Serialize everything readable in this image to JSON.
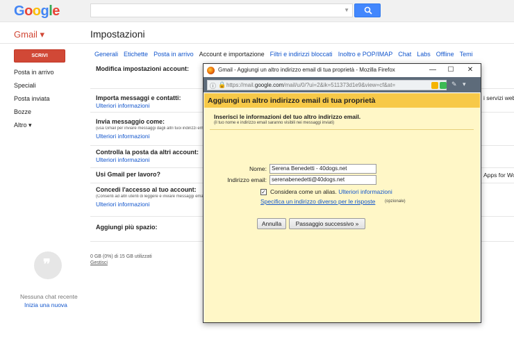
{
  "logo": {
    "text": "Google",
    "letters": [
      "G",
      "o",
      "o",
      "g",
      "l",
      "e"
    ],
    "colors": [
      "#4285f4",
      "#ea4335",
      "#fbbc05",
      "#4285f4",
      "#34a853",
      "#ea4335"
    ]
  },
  "header": {
    "gmail_label": "Gmail ▾",
    "page_title": "Impostazioni"
  },
  "compose": {
    "label": "SCRIVI"
  },
  "nav": {
    "items": [
      "Posta in arrivo",
      "Speciali",
      "Posta inviata",
      "Bozze",
      "Altro ▾"
    ]
  },
  "tabs": [
    "Generali",
    "Etichette",
    "Posta in arrivo",
    "Account e importazione",
    "Filtri e indirizzi bloccati",
    "Inoltro e POP/IMAP",
    "Chat",
    "Labs",
    "Offline",
    "Temi"
  ],
  "settings": {
    "modify_title": "Modifica impostazioni account:",
    "import_title": "Importa messaggi e contatti:",
    "import_link": "Ulteriori informazioni",
    "import_right": "i servizi web",
    "send_title": "Invia messaggio come:",
    "send_small": "(usa Gmail per inviare messaggi dagli altri tuoi indirizzi email)",
    "send_link": "Ulteriori informazioni",
    "check_title": "Controlla la posta da altri account:",
    "check_link": "Ulteriori informazioni",
    "work_title": "Usi Gmail per lavoro?",
    "work_right": "Apps for Wo",
    "access_title": "Concedi l'accesso al tuo account:",
    "access_small": "(Consenti ad altri utenti di leggere e inviare messaggi email",
    "access_link": "Ulteriori informazioni",
    "space_title": "Aggiungi più spazio:"
  },
  "storage": {
    "usage": "0 GB (0%) di 15 GB utilizzati",
    "manage": "Gestisci"
  },
  "chat": {
    "empty": "Nessuna chat recente",
    "start": "Inizia una nuova"
  },
  "popup": {
    "window_title": "Gmail - Aggiungi un altro indirizzo email di tua proprietà - Mozilla Firefox",
    "url_host": "https://mail.google.com",
    "url_host_bold": "google.com",
    "url_rest": "/mail/u/0/?ui=2&ik=511373d1e9&view=cf&at=",
    "heading": "Aggiungi un altro indirizzo email di tua proprietà",
    "intro": "Inserisci le informazioni del tuo altro indirizzo email.",
    "note": "(il tuo nome e indirizzo email saranno visibili nei messaggi inviati)",
    "name_label": "Nome:",
    "name_value": "Serena Benedetti - 40dogs.net",
    "email_label": "Indirizzo email:",
    "email_value": "serenabenedetti@40dogs.net",
    "alias_label": "Considera come un alias.",
    "alias_link": "Ulteriori informazioni",
    "reply_link": "Specifica un indirizzo diverso per le risposte",
    "optional": "(opzionale)",
    "cancel": "Annulla",
    "next": "Passaggio successivo »"
  }
}
